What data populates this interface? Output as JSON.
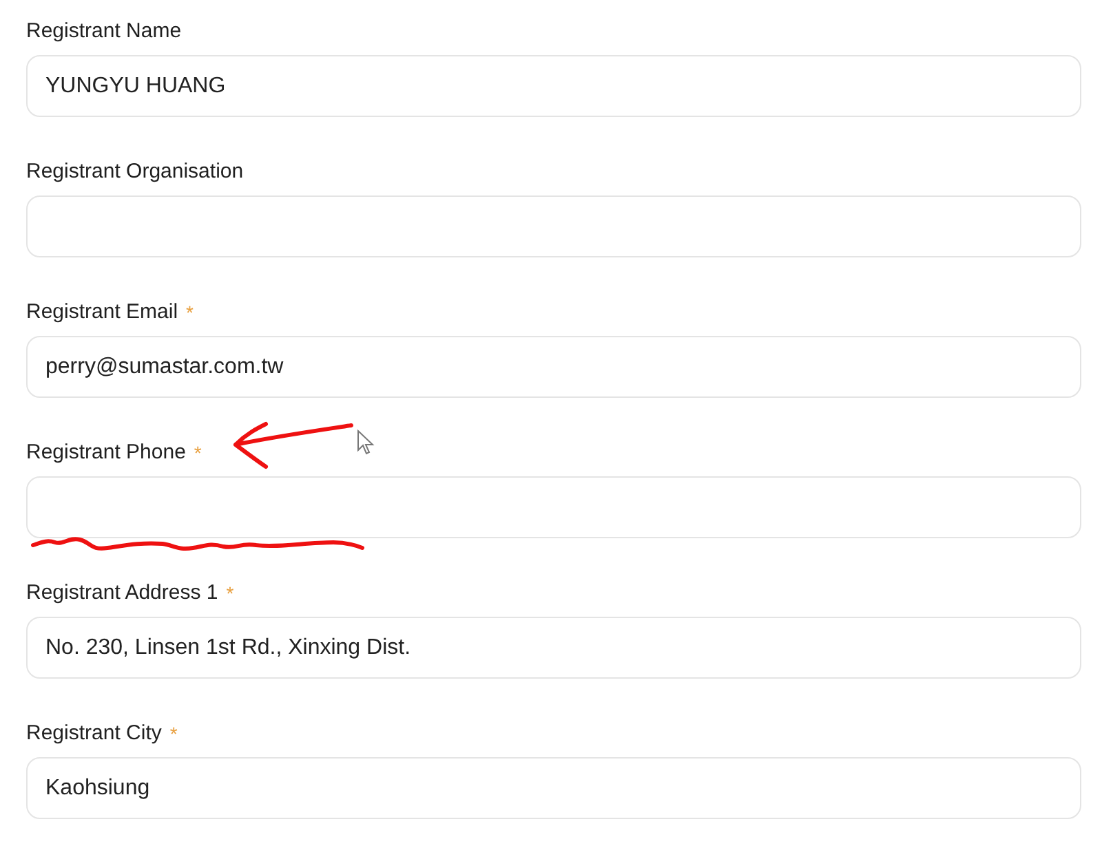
{
  "fields": [
    {
      "label": "Registrant Name",
      "value": "YUNGYU HUANG",
      "annotated": false
    },
    {
      "label": "Registrant Organisation",
      "annotated": false
    },
    {
      "label": "Registrant Email",
      "asterisk": "*",
      "value": "perry@sumastar.com.tw",
      "annotated": false
    },
    {
      "label": "Registrant Phone",
      "asterisk": "*",
      "annotated": true
    },
    {
      "label": "Registrant Address 1",
      "asterisk": "*",
      "value": "No. 230, Linsen 1st Rd., Xinxing Dist.",
      "annotated": false
    },
    {
      "label": "Registrant City",
      "asterisk": "*",
      "value": "Kaohsiung",
      "annotated": false
    }
  ]
}
